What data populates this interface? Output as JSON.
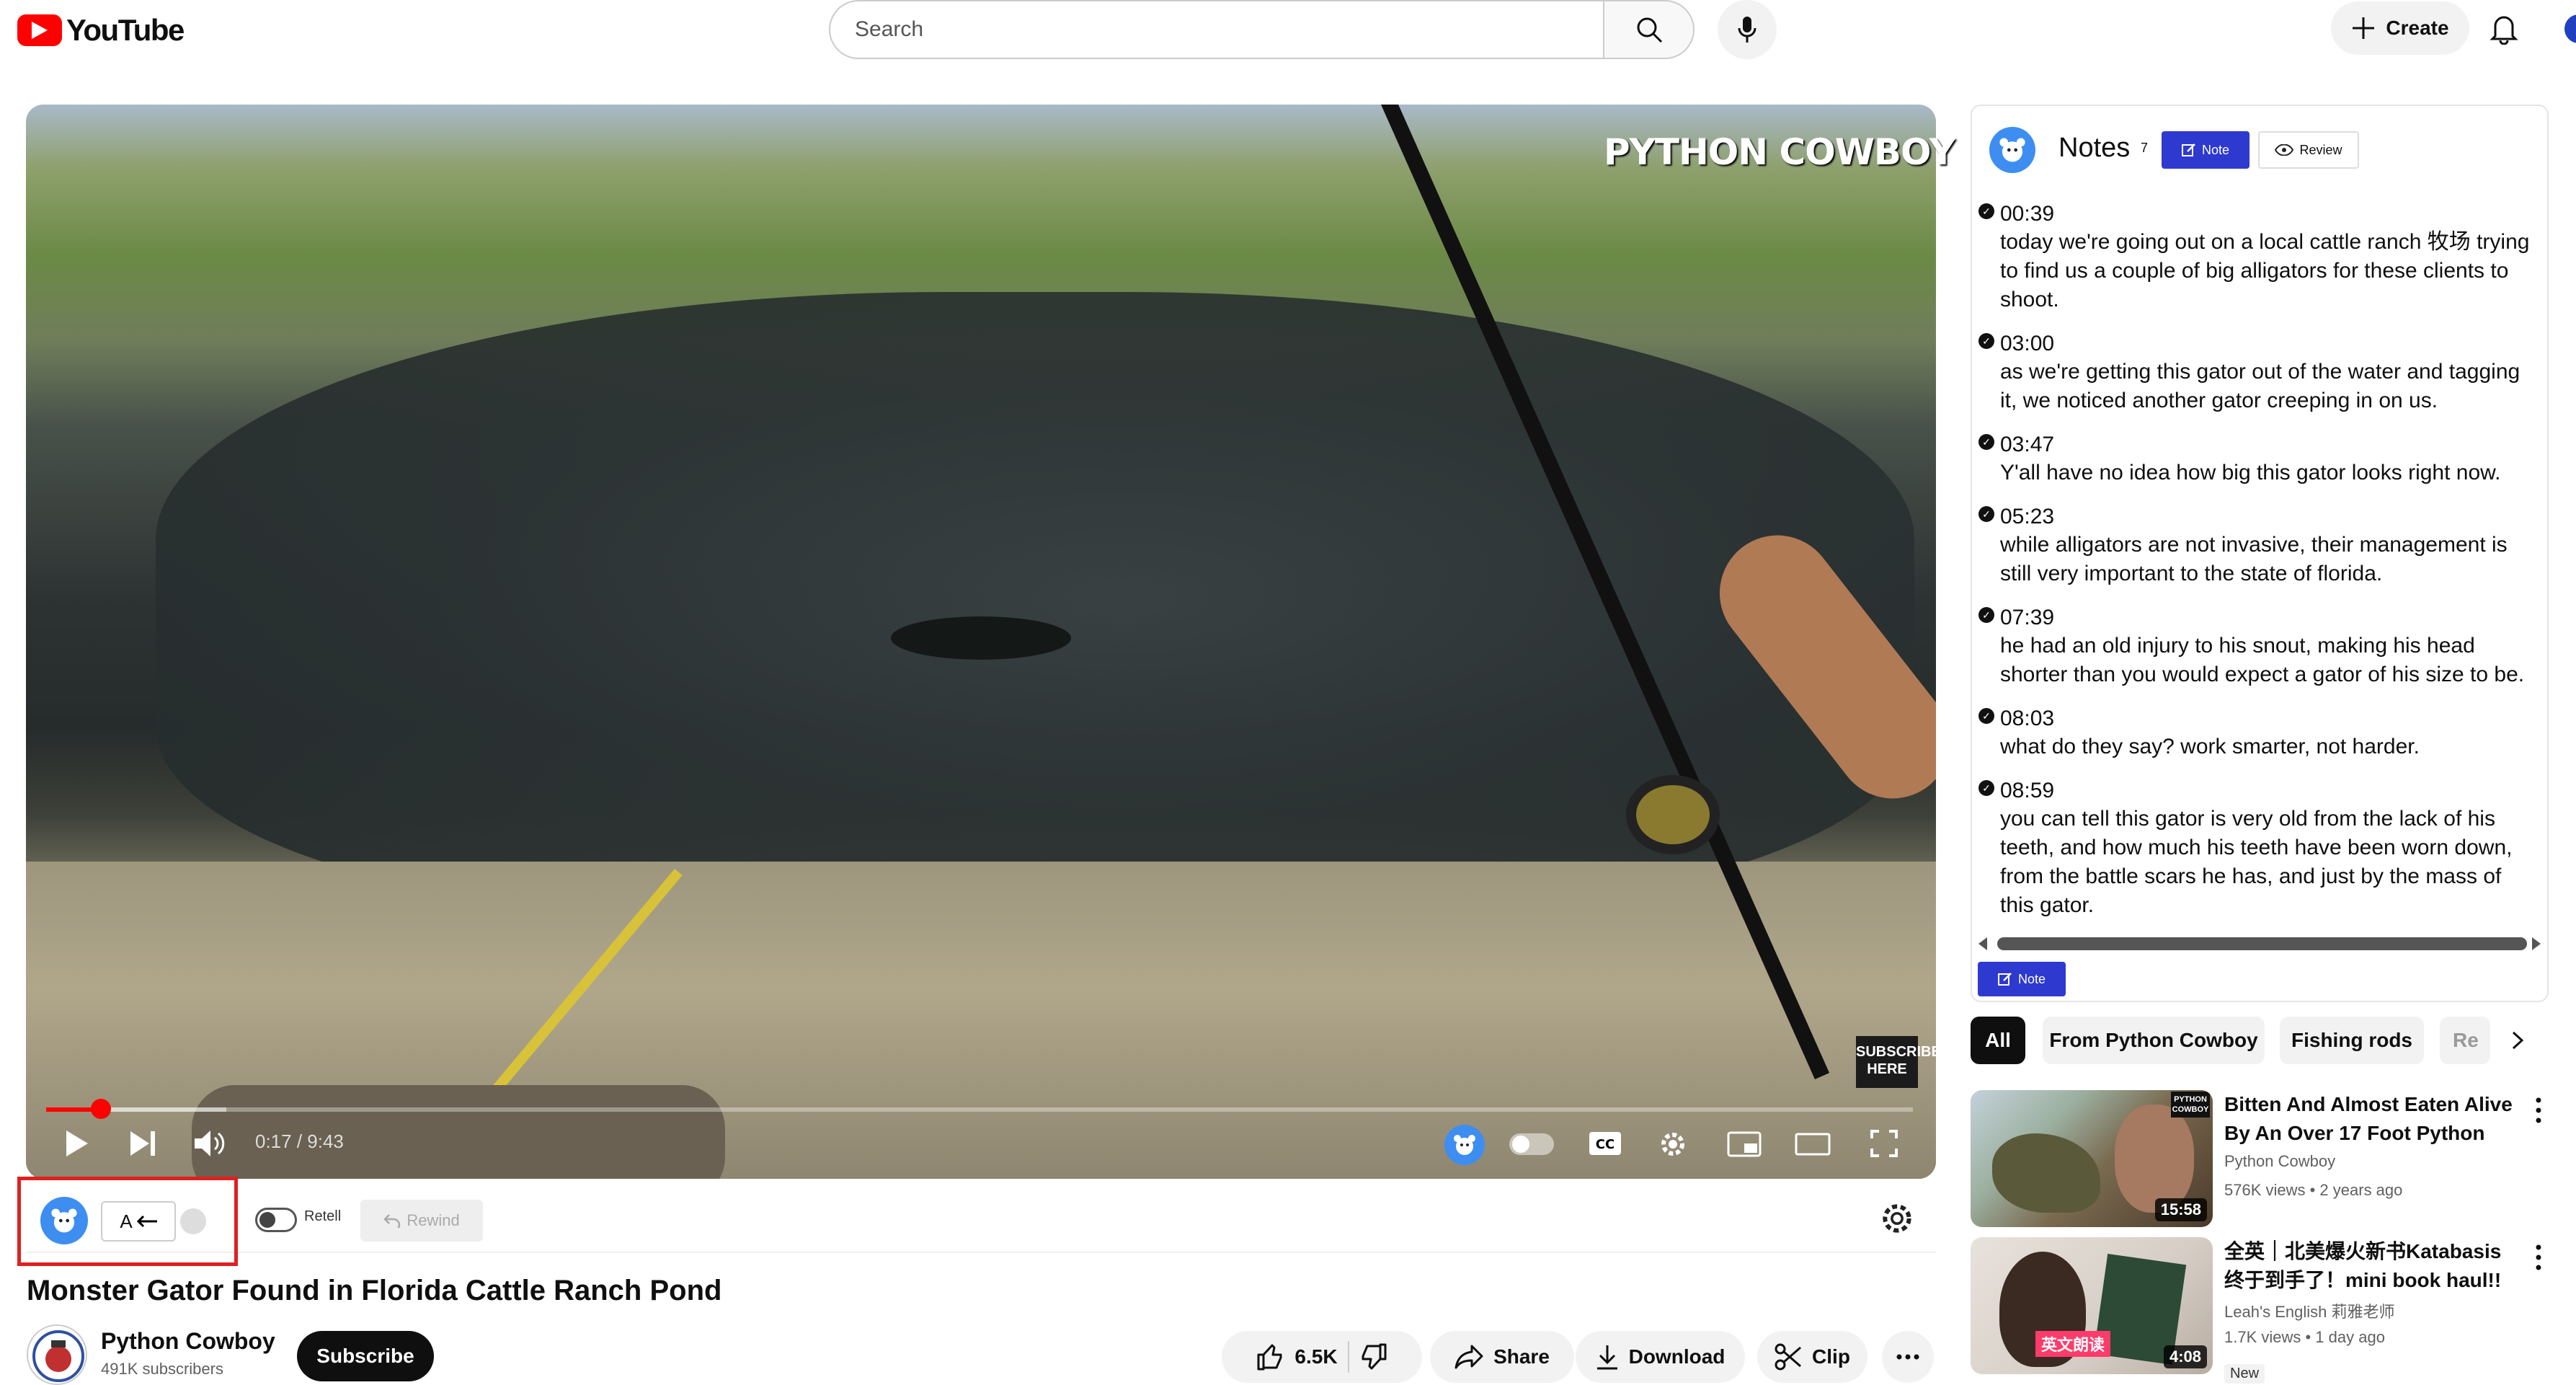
{
  "header": {
    "logo_text": "YouTube",
    "search_placeholder": "Search",
    "create_label": "Create"
  },
  "video": {
    "watermark": "PYTHON COWBOY",
    "subscribe_overlay": "SUBSCRIBE HERE",
    "time": "0:17 / 9:43",
    "progress": 0.03
  },
  "extension_bar": {
    "lang_label": "A",
    "retell_label": "Retell",
    "rewind_label": "Rewind"
  },
  "video_info": {
    "title": "Monster Gator Found in Florida Cattle Ranch Pond",
    "channel_name": "Python Cowboy",
    "subscribers": "491K subscribers",
    "subscribe_label": "Subscribe",
    "likes": "6.5K",
    "share_label": "Share",
    "download_label": "Download",
    "clip_label": "Clip"
  },
  "notes": {
    "title": "Notes",
    "count": "7",
    "note_btn": "Note",
    "review_btn": "Review",
    "items": [
      {
        "time": "00:39",
        "text": "today we're going out on a local cattle ranch 牧场 trying to find us a couple of big alligators for these clients to shoot."
      },
      {
        "time": "03:00",
        "text": "as we're getting this gator out of the water and tagging it, we noticed another gator creeping in on us."
      },
      {
        "time": "03:47",
        "text": "Y'all have no idea how big this gator looks right now."
      },
      {
        "time": "05:23",
        "text": "while alligators are not invasive, their management is still very important to the state of florida."
      },
      {
        "time": "07:39",
        "text": "he had an old injury to his snout, making his head shorter than you would expect a gator of his size to be."
      },
      {
        "time": "08:03",
        "text": "what do they say? work smarter, not harder."
      },
      {
        "time": "08:59",
        "text": "you can tell this gator is very old from the lack of his teeth, and how much his teeth have been worn down, from the battle scars he has, and just by the mass of this gator."
      }
    ]
  },
  "chips": [
    "All",
    "From Python Cowboy",
    "Fishing rods",
    "Re"
  ],
  "recommendations": [
    {
      "title": "Bitten And Almost Eaten Alive By An Over 17 Foot Python",
      "channel": "Python Cowboy",
      "meta": "576K views • 2 years ago",
      "duration": "15:58",
      "thumb_badge": "PYTHON COWBOY"
    },
    {
      "title": "全英｜北美爆火新书Katabasis 终于到手了！mini book haul!!",
      "channel": "Leah's English 莉雅老师",
      "meta": "1.7K views • 1 day ago",
      "duration": "4:08",
      "badge": "New",
      "thumb_caption": "英文朗读"
    }
  ],
  "colors": {
    "brand_red": "#ff0000",
    "ext_blue": "#2e39d0",
    "highlight_red": "#e02020"
  }
}
